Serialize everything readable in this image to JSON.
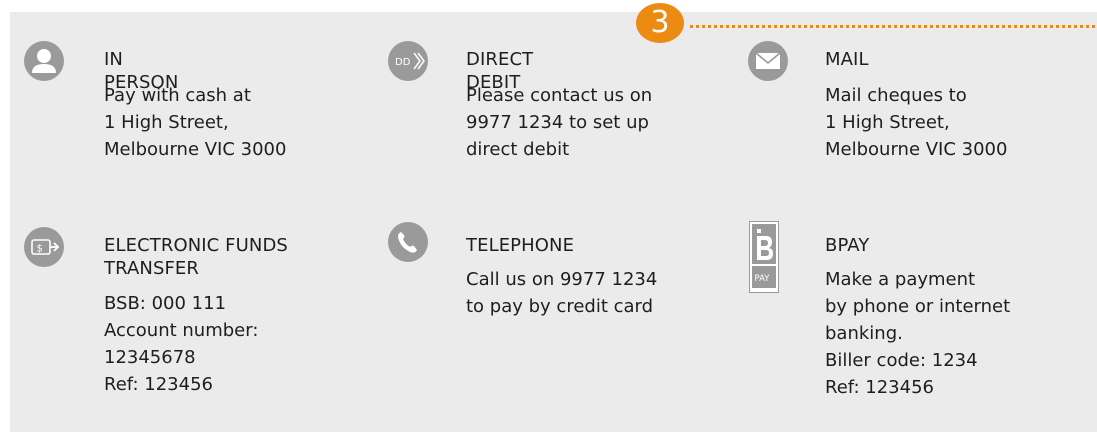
{
  "step_number": "3",
  "colors": {
    "accent": "#ec8a12",
    "icon_bg": "#9a9a9a",
    "panel_bg": "#ebebeb",
    "text": "#1e1e1e"
  },
  "methods": {
    "in_person": {
      "icon": "person-icon",
      "title": "IN PERSON",
      "lines": [
        "Pay with cash at",
        "1 High Street,",
        "Melbourne VIC 3000"
      ]
    },
    "direct_debit": {
      "icon": "direct-debit-icon",
      "icon_text": "DD",
      "title": "DIRECT DEBIT",
      "lines": [
        "Please contact us on",
        "9977 1234 to set up",
        "direct debit"
      ]
    },
    "mail": {
      "icon": "envelope-icon",
      "title": "MAIL",
      "lines": [
        "Mail cheques to",
        "1 High Street,",
        "Melbourne VIC 3000"
      ]
    },
    "eft": {
      "icon": "funds-transfer-icon",
      "icon_text": "$",
      "title_lines": [
        "ELECTRONIC FUNDS",
        "TRANSFER"
      ],
      "lines": [
        "BSB: 000 111",
        "Account number:",
        "12345678",
        "Ref: 123456"
      ]
    },
    "telephone": {
      "icon": "phone-icon",
      "title": "TELEPHONE",
      "lines": [
        "Call us on 9977 1234",
        "to pay by credit card"
      ]
    },
    "bpay": {
      "icon": "bpay-logo-icon",
      "logo_text": "PAY",
      "title": "BPAY",
      "lines": [
        "Make a payment",
        "by phone or  internet",
        "banking.",
        "Biller code: 1234",
        "Ref: 123456"
      ]
    }
  }
}
